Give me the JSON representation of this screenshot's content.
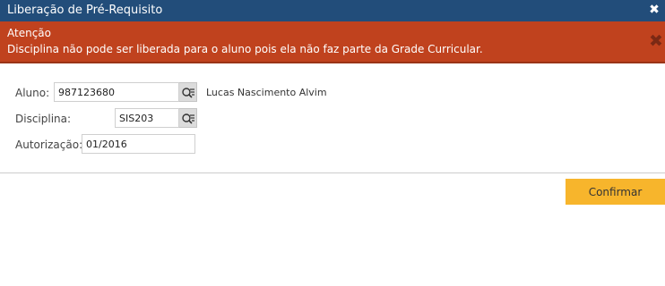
{
  "window": {
    "title": "Liberação de Pré-Requisito",
    "close_symbol": "✖"
  },
  "alert": {
    "title": "Atenção",
    "message": "Disciplina não pode ser liberada para o aluno pois ela não faz parte da Grade Curricular.",
    "close_symbol": "✖",
    "background_color": "#c0421e"
  },
  "form": {
    "aluno": {
      "label": "Aluno:",
      "value": "987123680",
      "name": "Lucas Nascimento Alvim",
      "lookup_icon": "search-list-icon"
    },
    "disciplina": {
      "label": "Disciplina:",
      "value": "SIS203",
      "lookup_icon": "search-list-icon"
    },
    "autorizacao": {
      "label": "Autorização:",
      "value": "01/2016"
    }
  },
  "actions": {
    "confirm_label": "Confirmar",
    "confirm_color": "#f7b52c"
  }
}
